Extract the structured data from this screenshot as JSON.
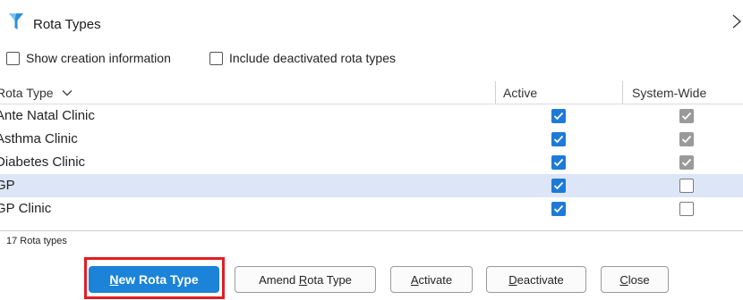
{
  "window": {
    "title": "Rota Types",
    "icon": "filter-funnel-icon"
  },
  "options": {
    "show_creation_info": {
      "label": "Show creation information",
      "checked": false
    },
    "include_deactivated": {
      "label": "Include deactivated rota types",
      "checked": false
    }
  },
  "grid": {
    "columns": {
      "rota_type": "Rota Type",
      "active": "Active",
      "system_wide": "System-Wide"
    },
    "sort_indicator": "chevron-down-icon",
    "rows": [
      {
        "name": "Ante Natal Clinic",
        "active": true,
        "system_wide": true
      },
      {
        "name": "Asthma Clinic",
        "active": true,
        "system_wide": true
      },
      {
        "name": "Diabetes Clinic",
        "active": true,
        "system_wide": true
      },
      {
        "name": "GP",
        "active": true,
        "system_wide": false,
        "selected": true
      },
      {
        "name": "GP Clinic",
        "active": true,
        "system_wide": false
      }
    ]
  },
  "footer": {
    "count_label": "17 Rota types"
  },
  "buttons": {
    "new_rota_type": {
      "mnemonic": "N",
      "rest": "ew Rota Type"
    },
    "amend_rota_type": {
      "prefix": "Amend ",
      "mnemonic": "R",
      "rest": "ota Type"
    },
    "activate": {
      "mnemonic": "A",
      "rest": "ctivate"
    },
    "deactivate": {
      "mnemonic": "D",
      "rest": "eactivate"
    },
    "close": {
      "mnemonic": "C",
      "rest": "lose"
    }
  },
  "colors": {
    "accent": "#1b83d8",
    "checkbox_active": "#1e7ad8",
    "checkbox_system": "#9a9a9a",
    "selected_row": "#dde6f6",
    "highlight_frame": "#e41c23"
  }
}
